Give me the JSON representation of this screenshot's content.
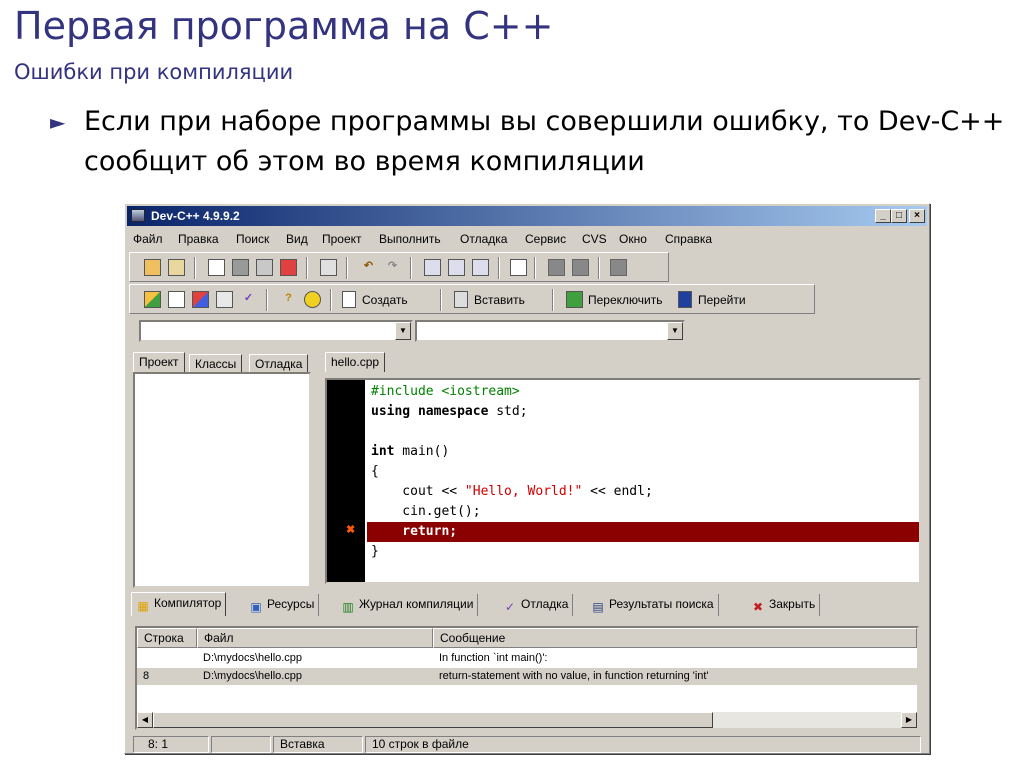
{
  "slide": {
    "title": "Первая программа на C++",
    "subtitle": "Ошибки при компиляции",
    "bullet_marker": "►",
    "bullet_text": "Если при наборе программы вы совершили ошибку, то Dev-C++ сообщит об этом во время компиляции"
  },
  "window": {
    "title": "Dev-C++ 4.9.9.2",
    "controls": {
      "minimize": "_",
      "maximize": "□",
      "close": "×"
    }
  },
  "menu": [
    "Файл",
    "Правка",
    "Поиск",
    "Вид",
    "Проект",
    "Выполнить",
    "Отладка",
    "Сервис",
    "CVS",
    "Окно",
    "Справка"
  ],
  "toolbar2": {
    "create": "Создать",
    "insert": "Вставить",
    "toggle": "Переключить",
    "goto": "Перейти"
  },
  "combos": {
    "left": "",
    "right": ""
  },
  "side_tabs": [
    "Проект",
    "Классы",
    "Отладка"
  ],
  "editor": {
    "file_tab": "hello.cpp",
    "lines": {
      "l1": "#include <iostream>",
      "l2_kw": "using namespace",
      "l2_rest": " std;",
      "l4_kw": "int",
      "l4_rest": " main()",
      "l5": "{",
      "l6_a": "    cout << ",
      "l6_str": "\"Hello, World!\"",
      "l6_b": " << endl;",
      "l7": "    cin.get();",
      "l8": "    return;",
      "l9": "}"
    }
  },
  "bottom_tabs": [
    "Компилятор",
    "Ресурсы",
    "Журнал компиляции",
    "Отладка",
    "Результаты поиска",
    "Закрыть"
  ],
  "messages": {
    "headers": {
      "line": "Строка",
      "file": "Файл",
      "message": "Сообщение"
    },
    "rows": [
      {
        "line": "",
        "file": "D:\\mydocs\\hello.cpp",
        "message": "In function `int main()':"
      },
      {
        "line": "8",
        "file": "D:\\mydocs\\hello.cpp",
        "message": "return-statement with no value, in function returning 'int'"
      }
    ]
  },
  "status": {
    "position": "8: 1",
    "modified": "",
    "mode": "Вставка",
    "info": "10 строк в файле"
  }
}
